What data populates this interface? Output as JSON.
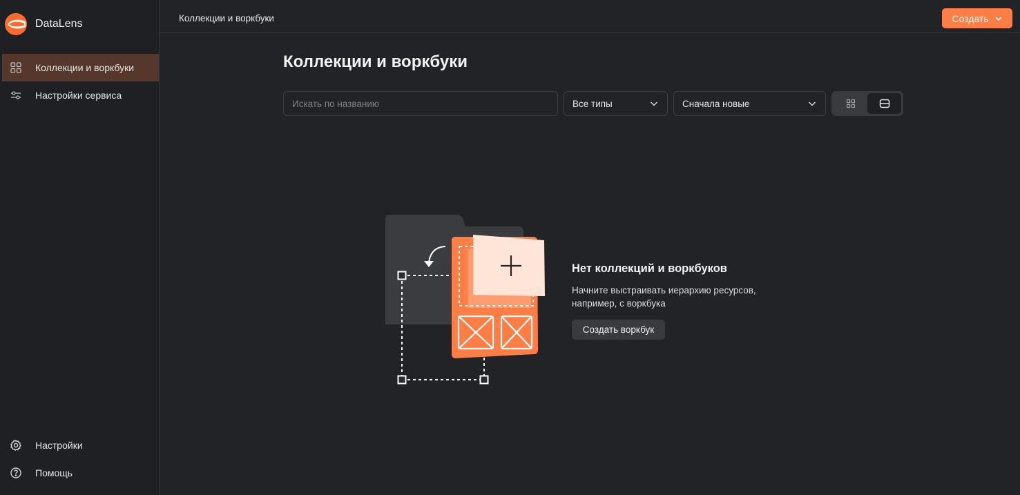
{
  "app": {
    "name": "DataLens"
  },
  "sidebar": {
    "items": [
      {
        "label": "Коллекции и воркбуки",
        "icon": "grid-icon",
        "active": true
      },
      {
        "label": "Настройки сервиса",
        "icon": "sliders-icon",
        "active": false
      }
    ],
    "footer": [
      {
        "label": "Настройки",
        "icon": "gear-icon"
      },
      {
        "label": "Помощь",
        "icon": "help-circle-icon"
      }
    ]
  },
  "header": {
    "breadcrumb": "Коллекции и воркбуки",
    "create_label": "Создать"
  },
  "main": {
    "title": "Коллекции и воркбуки",
    "search": {
      "placeholder": "Искать по названию",
      "value": ""
    },
    "type_filter": "Все типы",
    "sort": "Сначала новые",
    "view_mode": "list"
  },
  "empty_state": {
    "title": "Нет коллекций и воркбуков",
    "line1": "Начните выстраивать иерархию ресурсов,",
    "line2": "например, с воркбука",
    "button_label": "Создать воркбук"
  },
  "colors": {
    "accent": "#ff7e45",
    "active_nav": "#55372b",
    "background": "#222326",
    "sidebar": "#1f2023"
  }
}
